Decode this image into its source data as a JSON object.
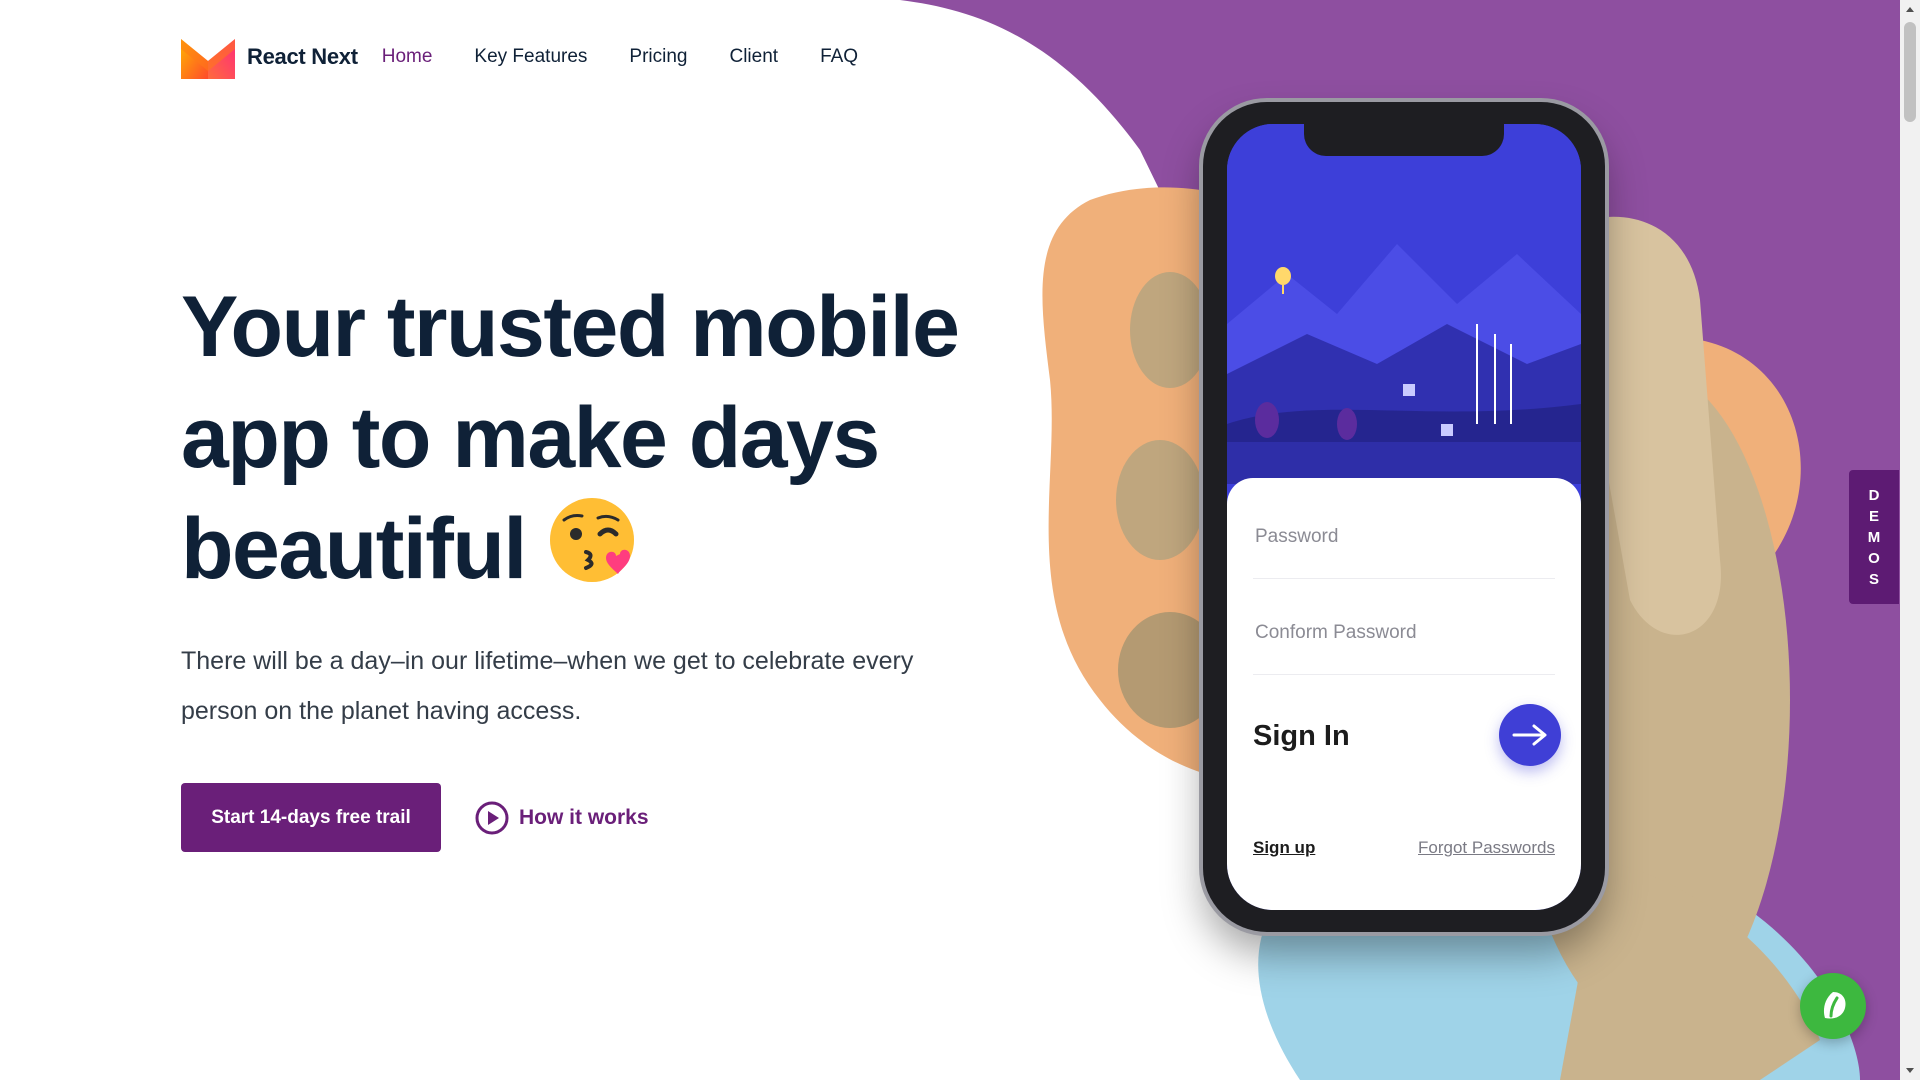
{
  "brand": {
    "name": "React Next"
  },
  "nav": {
    "items": [
      {
        "label": "Home",
        "active": true
      },
      {
        "label": "Key Features",
        "active": false
      },
      {
        "label": "Pricing",
        "active": false
      },
      {
        "label": "Client",
        "active": false
      },
      {
        "label": "FAQ",
        "active": false
      }
    ]
  },
  "hero": {
    "headline": "Your trusted mobile app to make days beautiful",
    "emoji_icon": "kissing-wink-heart-emoji",
    "description": "There will be a day–in our lifetime–when we get to celebrate every person on the planet having access.",
    "primary_button": "Start 14-days free trail",
    "secondary_button": "How it works"
  },
  "phone": {
    "password_placeholder": "Password",
    "confirm_placeholder": "Conform Password",
    "signin_title": "Sign In",
    "signup_link": "Sign up",
    "forgot_link": "Forgot Passwords"
  },
  "demos_tab": {
    "letters": [
      "D",
      "E",
      "M",
      "O",
      "S"
    ]
  },
  "icons": {
    "chat": "chat-bubble-icon",
    "play": "play-icon",
    "arrow": "arrow-right-icon"
  },
  "colors": {
    "primary": "#6a1f79",
    "headline": "#0f2137",
    "purple_bg": "#8e4fa0",
    "peach_blob": "#f0b07a",
    "blue_blob": "#9fd3e8",
    "phone_accent": "#3f3fd6",
    "chat_green": "#3db83f"
  }
}
